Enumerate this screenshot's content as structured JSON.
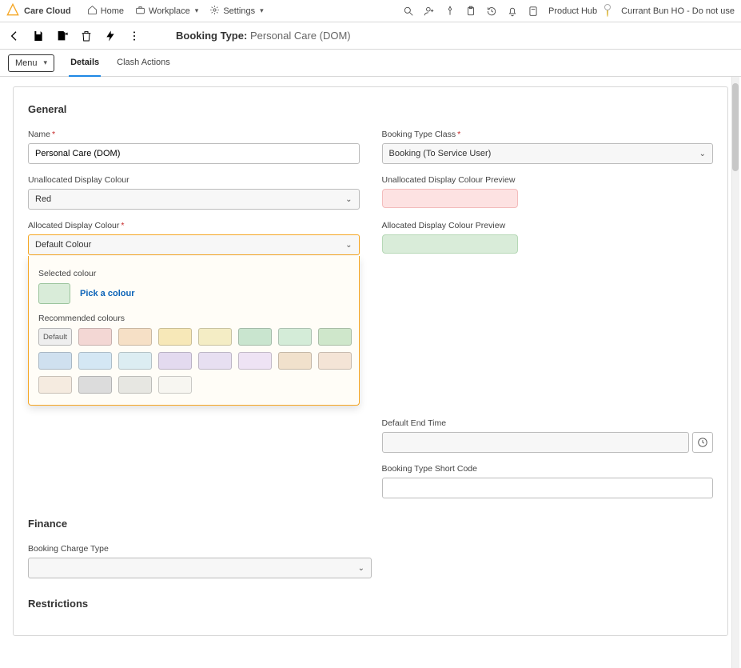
{
  "app": {
    "name": "Care Cloud"
  },
  "nav": {
    "home": "Home",
    "workplace": "Workplace",
    "settings": "Settings"
  },
  "top_right": {
    "product_hub": "Product Hub",
    "user": "Currant Bun HO - Do not use"
  },
  "record": {
    "type_label": "Booking Type:",
    "type_value": "Personal Care (DOM)"
  },
  "menu_button": "Menu",
  "tabs": {
    "details": "Details",
    "clash": "Clash Actions"
  },
  "sections": {
    "general": "General",
    "finance": "Finance",
    "restrictions": "Restrictions"
  },
  "labels": {
    "name": "Name",
    "booking_type_class": "Booking Type Class",
    "unalloc_colour": "Unallocated Display Colour",
    "unalloc_preview": "Unallocated Display Colour Preview",
    "alloc_colour": "Allocated Display Colour",
    "alloc_preview": "Allocated Display Colour Preview",
    "default_end": "Default End Time",
    "short_code": "Booking Type Short Code",
    "booking_charge_type": "Booking Charge Type"
  },
  "values": {
    "name": "Personal Care (DOM)",
    "booking_type_class": "Booking (To Service User)",
    "unalloc_colour": "Red",
    "alloc_colour": "Default Colour"
  },
  "picker": {
    "selected_label": "Selected colour",
    "pick_link": "Pick a colour",
    "recommended_label": "Recommended colours",
    "default_swatch": "Default"
  },
  "chart_data": {
    "type": "table",
    "title": "Recommended colours palette",
    "swatches": [
      {
        "label": "Default",
        "hex": "#eeeeee"
      },
      {
        "label": "",
        "hex": "#f3d7d4"
      },
      {
        "label": "",
        "hex": "#f6e0c6"
      },
      {
        "label": "",
        "hex": "#f7e8b8"
      },
      {
        "label": "",
        "hex": "#f4edc5"
      },
      {
        "label": "",
        "hex": "#c9e5cf"
      },
      {
        "label": "",
        "hex": "#d4ecd8"
      },
      {
        "label": "",
        "hex": "#cfe7cb"
      },
      {
        "label": "",
        "hex": "#cfe0ef"
      },
      {
        "label": "",
        "hex": "#d4e7f4"
      },
      {
        "label": "",
        "hex": "#dcedf2"
      },
      {
        "label": "",
        "hex": "#e3daef"
      },
      {
        "label": "",
        "hex": "#e7dff1"
      },
      {
        "label": "",
        "hex": "#eee3f4"
      },
      {
        "label": "",
        "hex": "#f1e1cc"
      },
      {
        "label": "",
        "hex": "#f4e4d6"
      },
      {
        "label": "",
        "hex": "#f5ebe0"
      },
      {
        "label": "",
        "hex": "#dcdcdc"
      },
      {
        "label": "",
        "hex": "#e7e7e2"
      },
      {
        "label": "",
        "hex": "#f7f6f1"
      }
    ]
  }
}
